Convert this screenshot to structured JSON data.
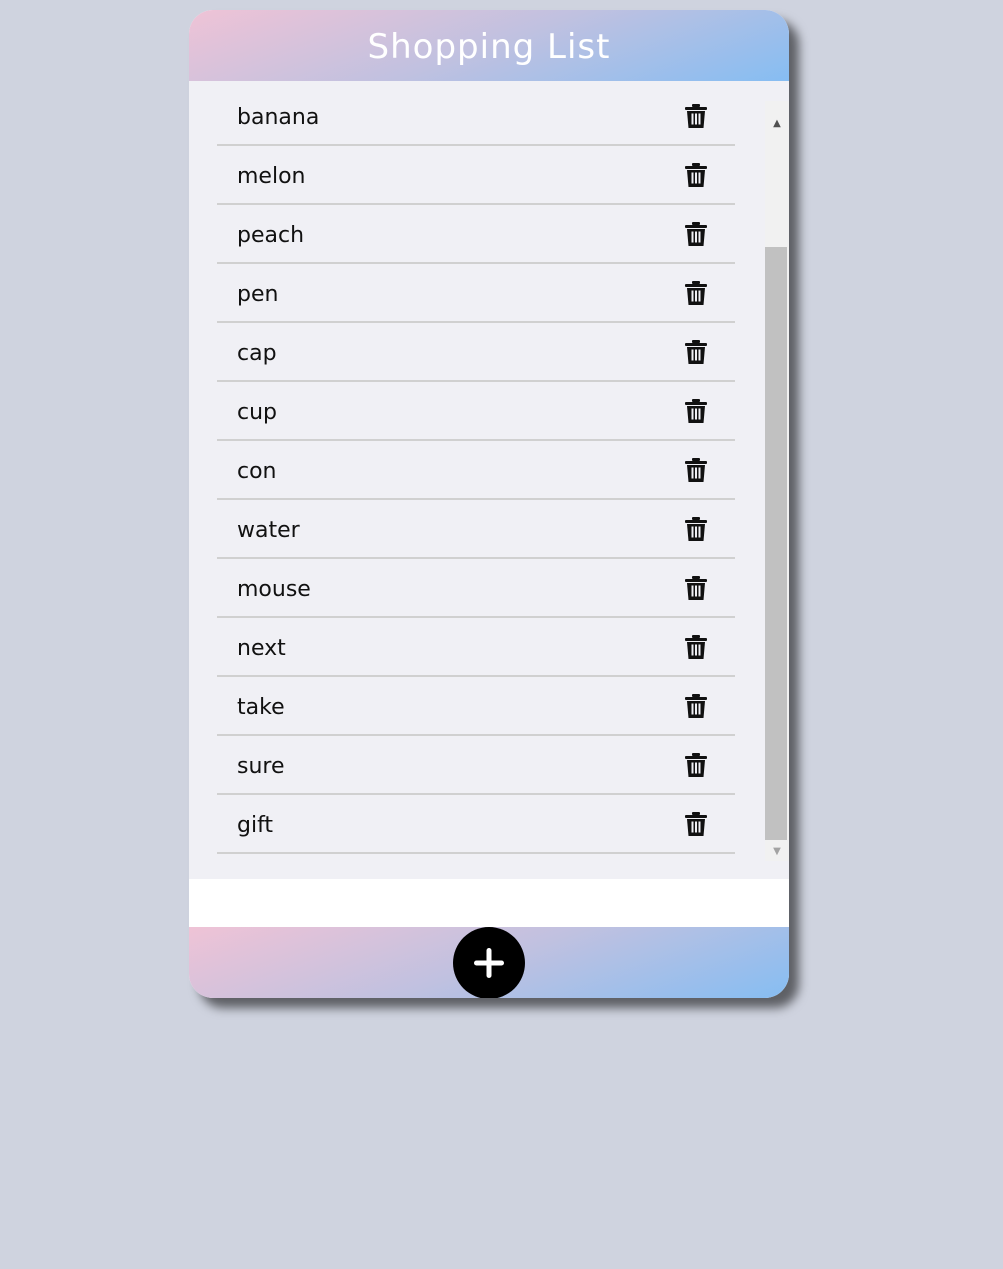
{
  "header": {
    "title": "Shopping List"
  },
  "list": {
    "items": [
      {
        "label": "banana",
        "icon": "trash-icon"
      },
      {
        "label": "melon",
        "icon": "trash-icon"
      },
      {
        "label": "peach",
        "icon": "trash-icon"
      },
      {
        "label": "pen",
        "icon": "trash-icon"
      },
      {
        "label": "cap",
        "icon": "trash-icon"
      },
      {
        "label": "cup",
        "icon": "trash-icon"
      },
      {
        "label": "con",
        "icon": "trash-icon"
      },
      {
        "label": "water",
        "icon": "trash-icon"
      },
      {
        "label": "mouse",
        "icon": "trash-icon"
      },
      {
        "label": "next",
        "icon": "trash-icon"
      },
      {
        "label": "take",
        "icon": "trash-icon"
      },
      {
        "label": "sure",
        "icon": "trash-icon"
      },
      {
        "label": "gift",
        "icon": "trash-icon"
      }
    ]
  },
  "footer": {
    "add_icon": "plus-icon"
  },
  "colors": {
    "page_background": "#cfd3df",
    "gradient_start": "#efc3d6",
    "gradient_mid": "#c0c1e0",
    "gradient_end": "#86bdf2",
    "list_background": "#f0f0f5",
    "title_text": "#ffffff",
    "add_button": "#000000"
  }
}
